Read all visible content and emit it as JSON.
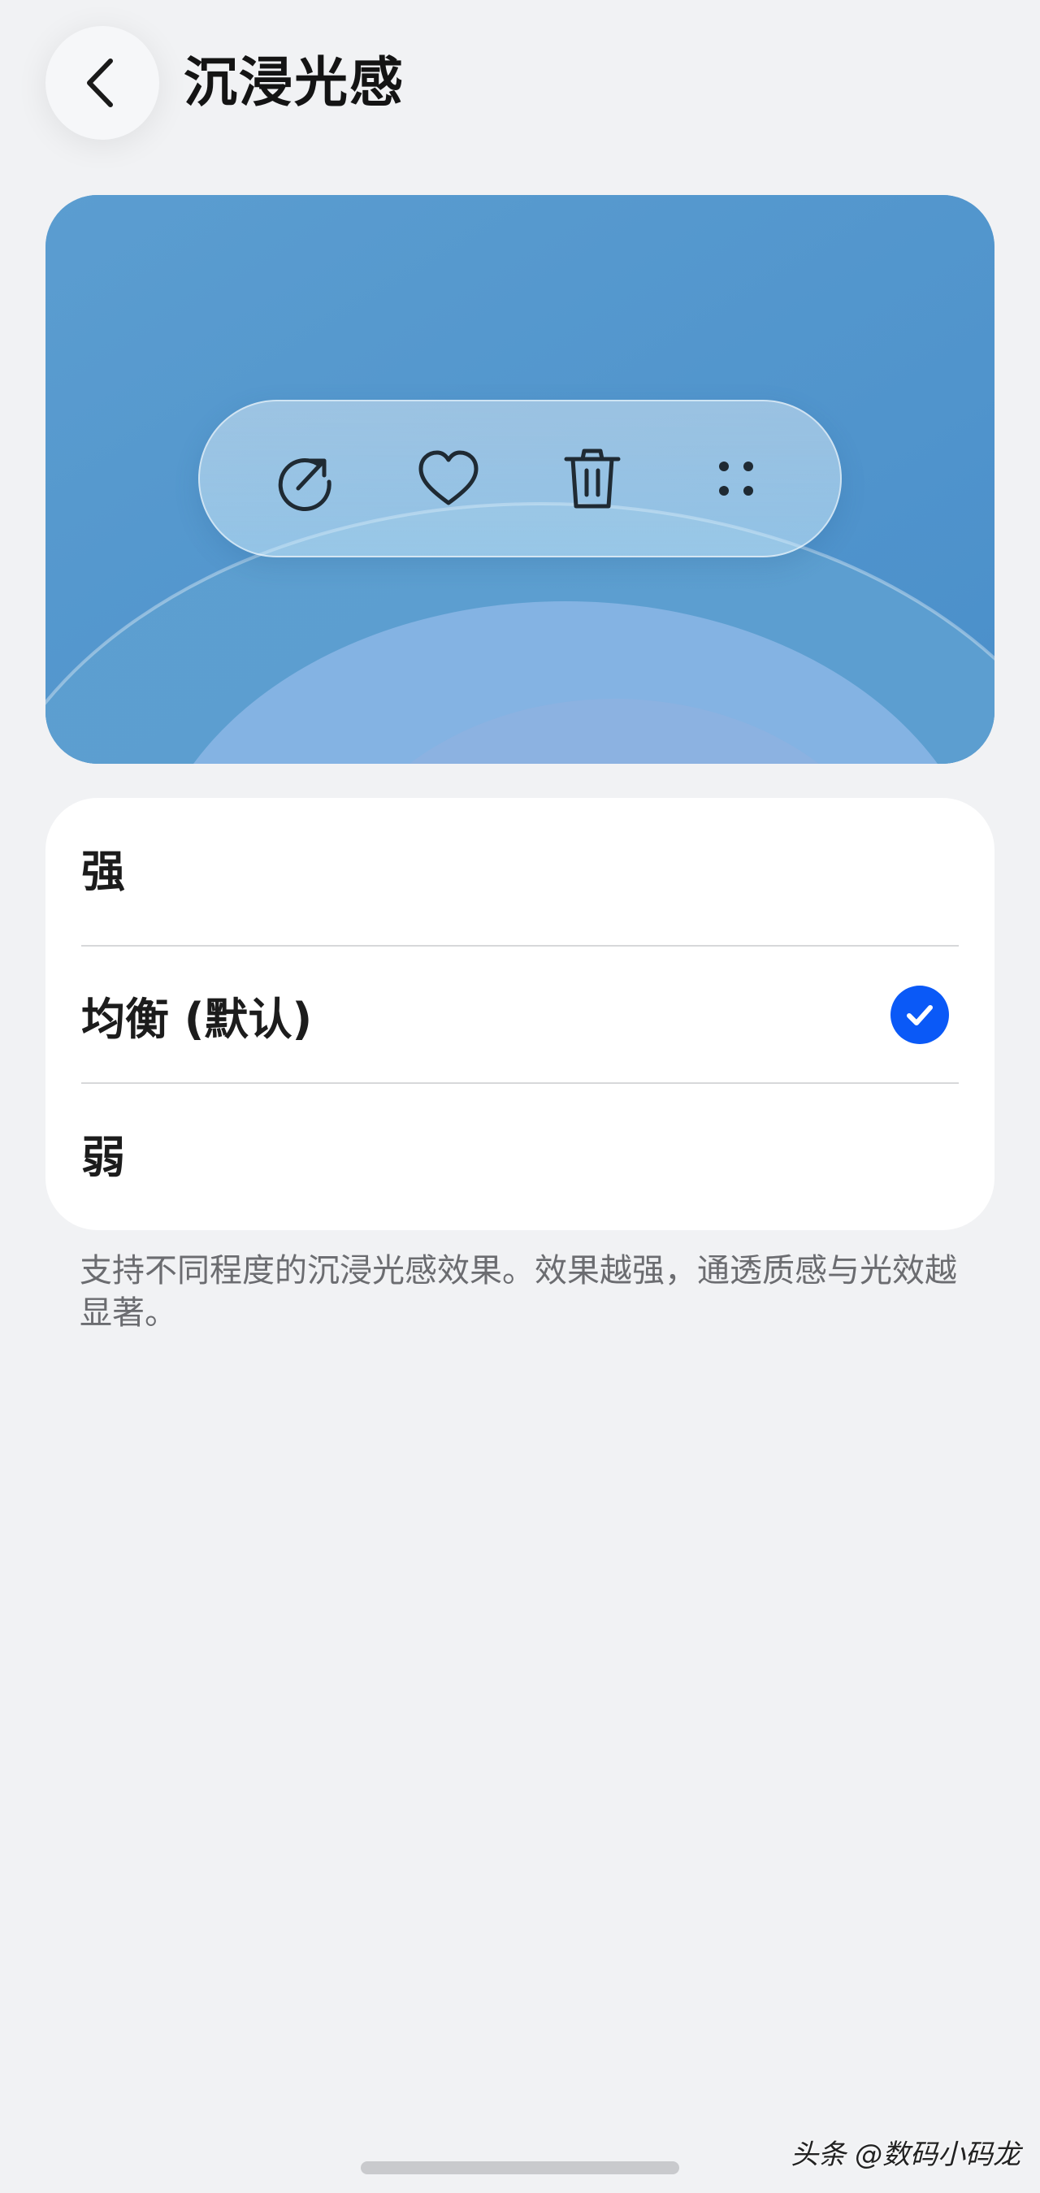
{
  "header": {
    "title": "沉浸光感",
    "back_icon": "chevron-left-icon"
  },
  "preview": {
    "action_icons": [
      "share-icon",
      "heart-icon",
      "trash-icon",
      "more-icon"
    ],
    "background_color": "#5d9fd0"
  },
  "options": {
    "items": [
      {
        "label": "强",
        "selected": false
      },
      {
        "label": "均衡 (默认)",
        "selected": true
      },
      {
        "label": "弱",
        "selected": false
      }
    ],
    "check_color": "#0a59f7"
  },
  "description": "支持不同程度的沉浸光感效果。效果越强，通透质感与光效越显著。",
  "watermark": "头条 @数码小码龙"
}
